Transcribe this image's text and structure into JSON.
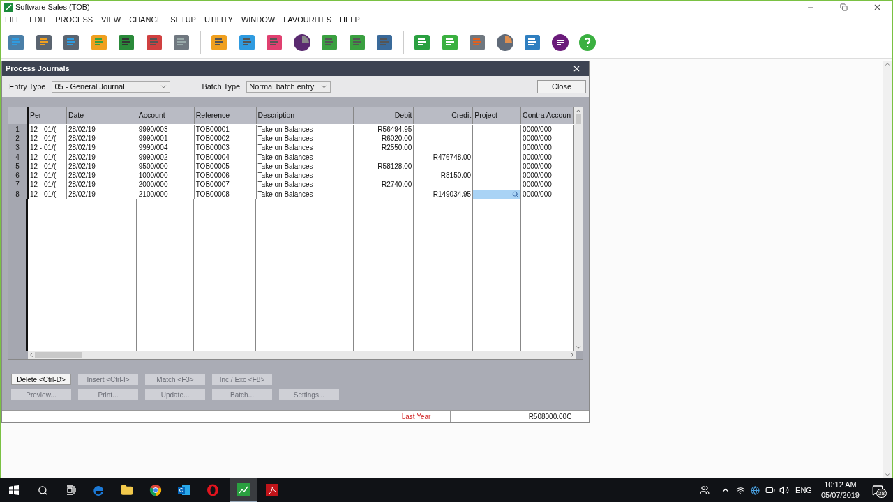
{
  "window": {
    "title": "Software Sales (TOB)"
  },
  "menu": [
    "FILE",
    "EDIT",
    "PROCESS",
    "VIEW",
    "CHANGE",
    "SETUP",
    "UTILITY",
    "WINDOW",
    "FAVOURITES",
    "HELP"
  ],
  "dialog": {
    "title": "Process Journals",
    "entry_type": {
      "label": "Entry Type",
      "value": "05 - General Journal"
    },
    "batch_type": {
      "label": "Batch Type",
      "value": "Normal batch entry"
    },
    "close_button": "Close",
    "table": {
      "columns": [
        "Per",
        "Date",
        "Account",
        "Reference",
        "Description",
        "Debit",
        "Credit",
        "Project",
        "Contra Accoun"
      ],
      "rows": [
        {
          "number": "1",
          "per": "12 - 01/(",
          "date": "28/02/19",
          "account": "9990/003",
          "reference": "TOB00001",
          "description": "Take on Balances",
          "debit": "R56494.95",
          "contra": "0000/000",
          "project_selected": false
        },
        {
          "number": "2",
          "per": "12 - 01/(",
          "date": "28/02/19",
          "account": "9990/001",
          "reference": "TOB00002",
          "description": "Take on Balances",
          "debit": "R6020.00",
          "contra": "0000/000",
          "project_selected": false
        },
        {
          "number": "3",
          "per": "12 - 01/(",
          "date": "28/02/19",
          "account": "9990/004",
          "reference": "TOB00003",
          "description": "Take on Balances",
          "debit": "R2550.00",
          "contra": "0000/000",
          "project_selected": false
        },
        {
          "number": "4",
          "per": "12 - 01/(",
          "date": "28/02/19",
          "account": "9990/002",
          "reference": "TOB00004",
          "description": "Take on Balances",
          "credit": "R476748.00",
          "contra": "0000/000",
          "project_selected": false
        },
        {
          "number": "5",
          "per": "12 - 01/(",
          "date": "28/02/19",
          "account": "9500/000",
          "reference": "TOB00005",
          "description": "Take on Balances",
          "debit": "R58128.00",
          "contra": "0000/000",
          "project_selected": false
        },
        {
          "number": "6",
          "per": "12 - 01/(",
          "date": "28/02/19",
          "account": "1000/000",
          "reference": "TOB00006",
          "description": "Take on Balances",
          "credit": "R8150.00",
          "contra": "0000/000",
          "project_selected": false
        },
        {
          "number": "7",
          "per": "12 - 01/(",
          "date": "28/02/19",
          "account": "2000/000",
          "reference": "TOB00007",
          "description": "Take on Balances",
          "debit": "R2740.00",
          "contra": "0000/000",
          "project_selected": false
        },
        {
          "number": "8",
          "per": "12 - 01/(",
          "date": "28/02/19",
          "account": "2100/000",
          "reference": "TOB00008",
          "description": "Take on Balances",
          "credit": "R149034.95",
          "contra": "0000/000",
          "project_selected": true
        }
      ]
    },
    "button_rows": [
      [
        {
          "label": "Delete <Ctrl-D>",
          "disabled": false
        },
        {
          "label": "Insert <Ctrl-I>",
          "disabled": true
        },
        {
          "label": "Match <F3>",
          "disabled": true
        },
        {
          "label": "Inc / Exc <F8>",
          "disabled": true
        }
      ],
      [
        {
          "label": "Preview...",
          "disabled": true
        },
        {
          "label": "Print...",
          "disabled": true
        },
        {
          "label": "Update...",
          "disabled": true
        },
        {
          "label": "Batch...",
          "disabled": true
        },
        {
          "label": "Settings...",
          "disabled": true
        }
      ]
    ],
    "status_bar": {
      "period": "Last Year",
      "balance": "R508000.00C"
    }
  },
  "taskbar": {
    "language": "ENG",
    "time": "10:12 AM",
    "date": "05/07/2019",
    "notifications": "28"
  }
}
